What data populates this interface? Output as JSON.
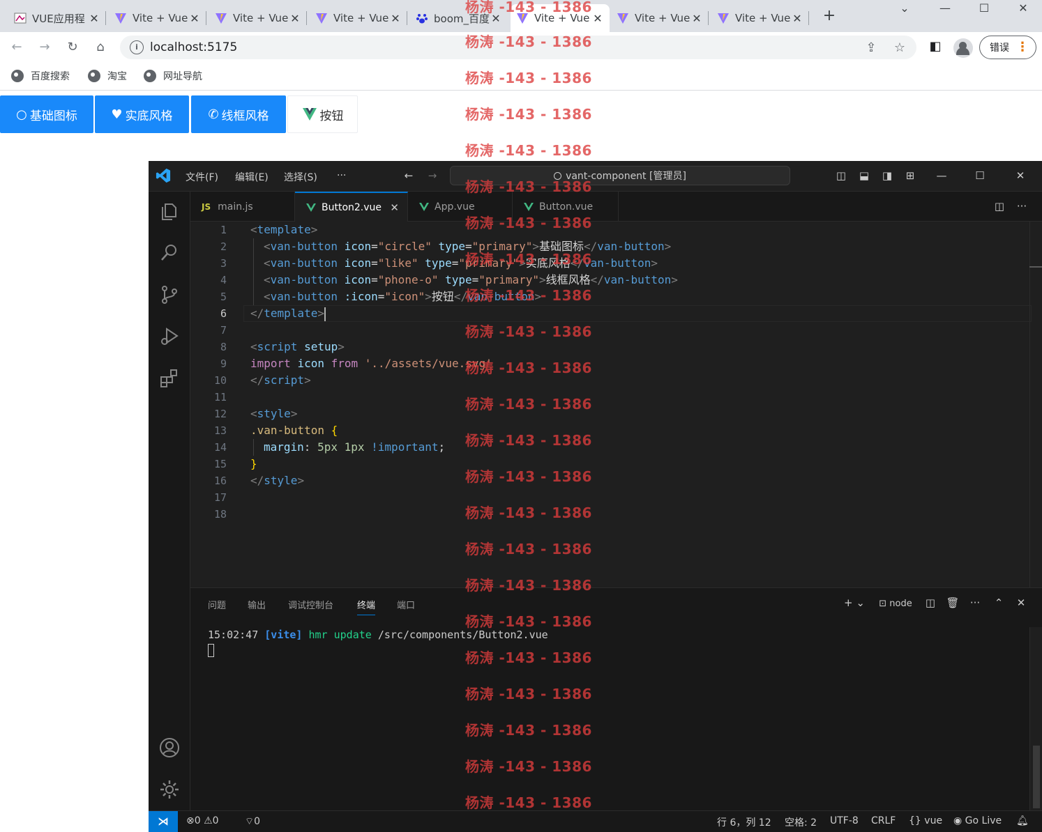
{
  "browser": {
    "tabs": [
      {
        "title": "VUE应用程",
        "icon": "generic-favicon-icon"
      },
      {
        "title": "Vite + Vue",
        "icon": "vite-icon"
      },
      {
        "title": "Vite + Vue",
        "icon": "vite-icon"
      },
      {
        "title": "Vite + Vue",
        "icon": "vite-icon"
      },
      {
        "title": "boom_百度",
        "icon": "baidu-paw-icon"
      },
      {
        "title": "Vite + Vue",
        "icon": "vite-icon",
        "active": true
      },
      {
        "title": "Vite + Vue",
        "icon": "vite-icon"
      },
      {
        "title": "Vite + Vue",
        "icon": "vite-icon"
      }
    ],
    "url": "localhost:5175",
    "profile_error_label": "错误",
    "bookmarks": [
      "百度搜索",
      "淘宝",
      "网址导航"
    ]
  },
  "page": {
    "buttons": [
      {
        "label": "基础图标",
        "icon": "circle-icon",
        "type": "primary"
      },
      {
        "label": "实底风格",
        "icon": "heart-icon",
        "type": "primary"
      },
      {
        "label": "线框风格",
        "icon": "phone-icon",
        "type": "primary"
      },
      {
        "label": "按钮",
        "icon": "vue-logo-icon",
        "type": "plain"
      }
    ]
  },
  "vscode": {
    "menu": [
      "文件(F)",
      "编辑(E)",
      "选择(S)",
      "···"
    ],
    "command_center": "vant-component [管理员]",
    "tabs": [
      {
        "label": "main.js",
        "kind": "js"
      },
      {
        "label": "Button2.vue",
        "kind": "vue",
        "active": true
      },
      {
        "label": "App.vue",
        "kind": "vue"
      },
      {
        "label": "Button.vue",
        "kind": "vue"
      }
    ],
    "line_numbers": [
      "1",
      "2",
      "3",
      "4",
      "5",
      "6",
      "7",
      "8",
      "9",
      "10",
      "11",
      "12",
      "13",
      "14",
      "15",
      "16",
      "17",
      "18"
    ],
    "current_line": 6,
    "code": {
      "l1": [
        "<",
        "template",
        ">"
      ],
      "l2": [
        "<",
        "van-button",
        " ",
        "icon",
        "=",
        "\"circle\"",
        " ",
        "type",
        "=",
        "\"primary\"",
        ">",
        "基础图标",
        "</",
        "van-button",
        ">"
      ],
      "l3": [
        "<",
        "van-button",
        " ",
        "icon",
        "=",
        "\"like\"",
        " ",
        "type",
        "=",
        "\"primary\"",
        ">",
        "实底风格",
        "</",
        "van-button",
        ">"
      ],
      "l4": [
        "<",
        "van-button",
        " ",
        "icon",
        "=",
        "\"phone-o\"",
        " ",
        "type",
        "=",
        "\"primary\"",
        ">",
        "线框风格",
        "</",
        "van-button",
        ">"
      ],
      "l5": [
        "<",
        "van-button",
        " ",
        ":icon",
        "=",
        "\"icon\"",
        ">",
        "按钮",
        "</",
        "van-button",
        ">"
      ],
      "l6": [
        "</",
        "template",
        ">"
      ],
      "l8": [
        "<",
        "script",
        " ",
        "setup",
        ">"
      ],
      "l9": [
        "import",
        " ",
        "icon",
        " ",
        "from",
        " ",
        "'../assets/vue.svg'"
      ],
      "l10": [
        "</",
        "script",
        ">"
      ],
      "l12": [
        "<",
        "style",
        ">"
      ],
      "l13": [
        ".van-button",
        " ",
        "{"
      ],
      "l14": [
        "margin",
        ": ",
        "5px",
        " ",
        "1px",
        " ",
        "!important",
        ";"
      ],
      "l15": [
        "}"
      ],
      "l16": [
        "</",
        "style",
        ">"
      ]
    },
    "panel_tabs": [
      "问题",
      "输出",
      "调试控制台",
      "终端",
      "端口"
    ],
    "active_panel_tab": "终端",
    "terminal_shell": "node",
    "terminal_line": {
      "time": "15:02:47",
      "tag": "[vite]",
      "msg": "hmr update",
      "path": "/src/components/Button2.vue"
    },
    "status": {
      "errors": "0",
      "warnings": "0",
      "ports": "0",
      "position": "行 6，列 12",
      "spaces": "空格: 2",
      "encoding": "UTF-8",
      "eol": "CRLF",
      "language": "vue",
      "golive": "Go Live"
    }
  },
  "watermark": "杨涛 -143 - 1386",
  "colors": {
    "vant_primary": "#1989fa",
    "vscode_accent": "#0078d4",
    "vue_green": "#41b883"
  }
}
